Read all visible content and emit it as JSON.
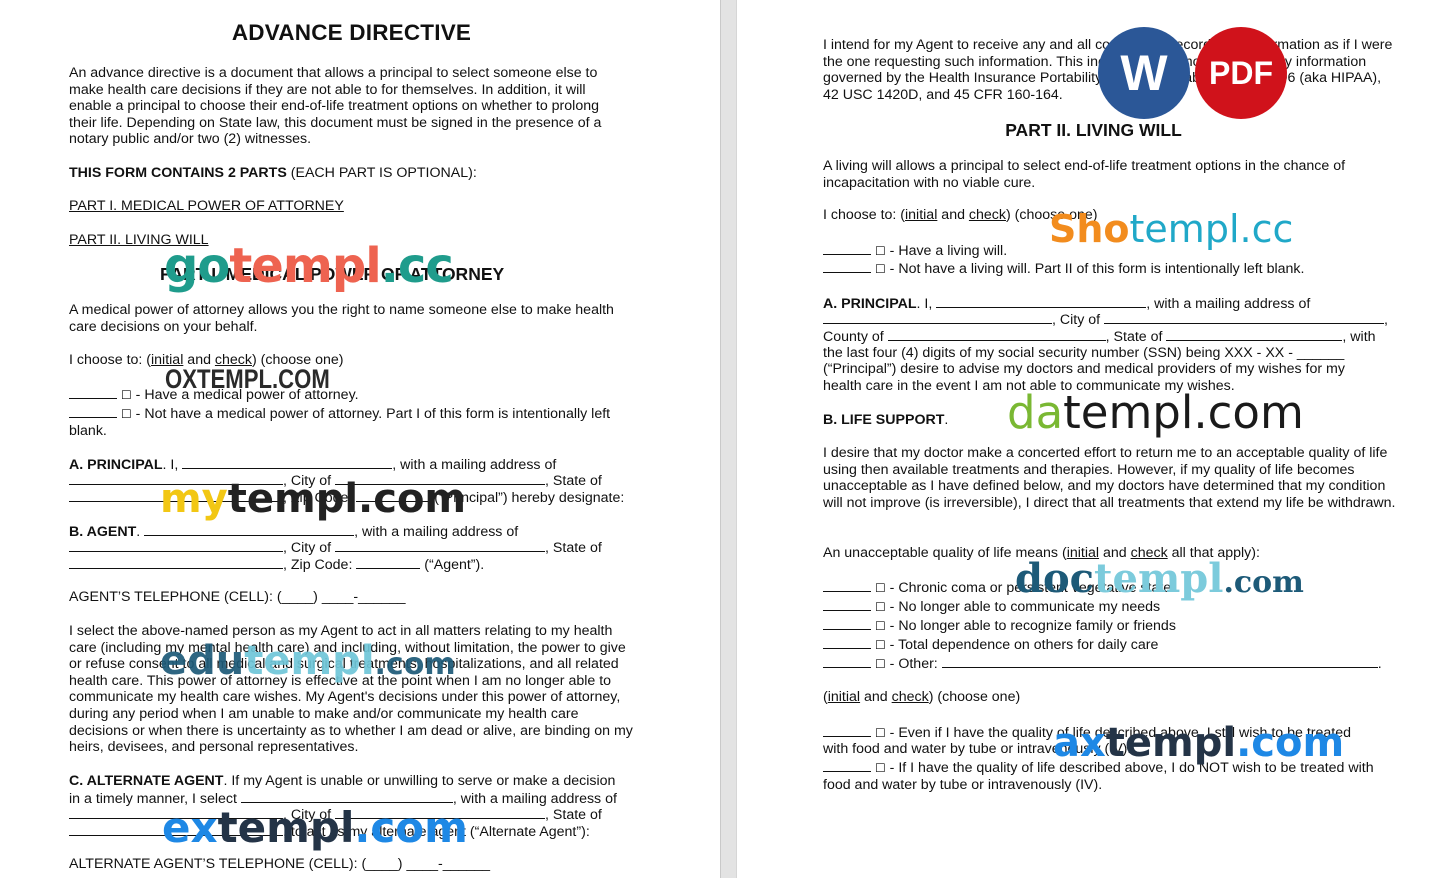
{
  "left_page": {
    "title": "ADVANCE DIRECTIVE",
    "intro": "An advance directive is a document that allows a principal to select someone else to make health care decisions if they are not able to for themselves. In addition, it will enable a principal to choose their end-of-life treatment options on whether to prolong their life. Depending on State law, this document must be signed in the presence of a notary public and/or two (2) witnesses.",
    "form_contains_bold": "THIS FORM CONTAINS 2 PARTS",
    "form_contains_rest": " (EACH PART IS OPTIONAL):",
    "part1_link": "PART I.  MEDICAL POWER OF ATTORNEY",
    "part2_link": "PART II. LIVING WILL",
    "part1_heading": "PART I. MEDICAL POWER OF ATTORNEY",
    "mpoa_desc": "A medical power of attorney allows you the right to name someone else to make health care decisions on your behalf.",
    "choose_prefix": "I choose to: (",
    "choose_initial": "initial",
    "choose_and": " and ",
    "choose_check": "check",
    "choose_suffix": ") (choose one)",
    "options": [
      {
        "box": "☐",
        "text": " - Have a medical power of attorney."
      },
      {
        "box": "☐",
        "text": " - Not have a medical power of attorney. Part I of this form is intentionally left"
      }
    ],
    "option_wrap": "blank.",
    "principal": {
      "label": "A. PRINCIPAL",
      "l1_a": ". I, ",
      "l1_b": ", with a mailing address of",
      "l2_a": ", City of ",
      "l2_b": ", State of",
      "l3_a": ", Zip Code: ",
      "l3_b": " (“Principal”) hereby designate:"
    },
    "agent": {
      "label": "B. AGENT",
      "l1_a": ". ",
      "l1_b": ", with a mailing address of",
      "l2_a": ", City of ",
      "l2_b": ", State of",
      "l3_a": ", Zip Code: ",
      "l3_b": " (“Agent”)."
    },
    "agent_phone": "AGENT’S TELEPHONE (CELL): (____) ____-______",
    "select_paragraph": "I select the above-named person as my Agent to act in all matters relating to my health care (including my mental health care) and including, without limitation, the power to give or refuse consent to all medical and surgical treatments, hospitalizations, and all related health care. This power of attorney is effective at the point when I am no longer able to communicate my health care wishes. My Agent's decisions under this power of attorney, during any period when I am unable to make and/or communicate my health care decisions or when there is uncertainty as to whether I am dead or alive, are binding on my heirs, devisees, and personal representatives.",
    "alternate": {
      "label": "C. ALTERNATE AGENT",
      "l1": ". If my Agent is unable or unwilling to serve or make a decision",
      "l2_a": "in a timely manner, I select ",
      "l2_b": ", with a mailing address of",
      "l3_a": ", City of ",
      "l3_b": ", State of",
      "l4": ", to act as my alternate agent (“Alternate Agent”):"
    },
    "alt_phone": "ALTERNATE AGENT’S TELEPHONE (CELL): (____) ____-______"
  },
  "right_page": {
    "hipaa_paragraph": "I intend for my Agent to receive any and all confidential records and information as if I were the one requesting such information. This includes, but is not limited to any information governed by the Health Insurance Portability and Accountability Act of 1996 (aka HIPAA), 42 USC 1420D, and 45 CFR 160-164.",
    "part2_heading": "PART II. LIVING WILL",
    "lw_desc": "A living will allows a principal to select end-of-life treatment options in the chance of incapacitation with no viable cure.",
    "choose_prefix": "I choose to: (",
    "choose_initial": "initial",
    "choose_and": " and ",
    "choose_check": "check",
    "choose_suffix": ") (choose one)",
    "options": [
      {
        "box": "☐",
        "text": " - Have a living will."
      },
      {
        "box": "☐",
        "text": " - Not have a living will. Part II of this form is intentionally left blank."
      }
    ],
    "principal": {
      "label": "A. PRINCIPAL",
      "l1_a": ". I, ",
      "l1_b": ", with a mailing address of",
      "l2_a": ", City of ",
      "l3_a": "County of ",
      "l3_b": ", State of ",
      "l3_c": ", with",
      "l4": "the last four (4) digits of my social security number (SSN) being XXX - XX - ______",
      "l5": "(“Principal”) desire to advise my doctors and medical providers of my wishes for my",
      "l6": "health care in the event I am not able to communicate my wishes."
    },
    "life_support_label": "B. LIFE SUPPORT",
    "life_support_dot": ".",
    "desire_paragraph": "I desire that my doctor make a concerted effort to return me to an acceptable quality of life using then available treatments and therapies. However, if my quality of life becomes unacceptable as I have defined below, and my doctors have determined that my condition will not improve (is irreversible), I direct that all treatments that extend my life be withdrawn.",
    "unacceptable_prefix": "An unacceptable quality of life means (",
    "unacceptable_initial": "initial",
    "unacceptable_and": " and ",
    "unacceptable_check": "check",
    "unacceptable_suffix": " all that apply):",
    "conditions": [
      {
        "box": "☐",
        "text": " - Chronic coma or persistent vegetative state"
      },
      {
        "box": "☐",
        "text": " - No longer able to communicate my needs"
      },
      {
        "box": "☐",
        "text": " - No longer able to recognize family or friends"
      },
      {
        "box": "☐",
        "text": " - Total dependence on others for daily care"
      },
      {
        "box": "☐",
        "text": " - Other: "
      }
    ],
    "choose2_prefix": "(",
    "choose2_initial": "initial",
    "choose2_and": " and ",
    "choose2_check": "check",
    "choose2_suffix": ") (choose one)",
    "feeding_options": [
      {
        "box": "☐",
        "l1": " - Even if I have the quality of life described above, I still wish to be treated",
        "l2": "with food and water by tube or intravenously (IV)."
      },
      {
        "box": "☐",
        "l1": " - If I have the quality of life described above, I do NOT wish to be treated with",
        "l2": "food and water by tube or intravenously (IV)."
      }
    ]
  },
  "badges": {
    "word_label": "W",
    "pdf_label": "PDF",
    "word_color": "#2b5797",
    "pdf_color": "#d0121b"
  },
  "watermarks": {
    "gotempl": {
      "a": "go",
      "b": "templ",
      "c": ".cc"
    },
    "oxtempl": "OXTEMPL.COM",
    "mytempl": {
      "a": "my",
      "b": "templ.com"
    },
    "edutempl": {
      "a": "edu",
      "b": "templ",
      "c": ".com"
    },
    "extempl": {
      "a": "ex",
      "b": "templ",
      "c": ".com"
    },
    "shotempl": {
      "a": "Sho",
      "b": "templ.cc"
    },
    "datempl": {
      "a": "da",
      "b": "templ.com"
    },
    "doctempl": {
      "a": "doc",
      "b": "templ",
      "c": ".com"
    },
    "axtempl": {
      "a": "ax",
      "b": "templ",
      "c": ".com"
    }
  }
}
